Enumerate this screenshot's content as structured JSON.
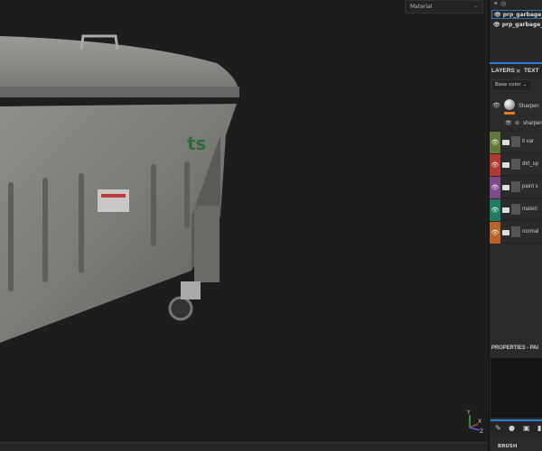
{
  "viewport": {
    "display_mode": "Material",
    "gizmo_axes": [
      "Y",
      "X",
      "Z"
    ]
  },
  "texture_sets": [
    "prp_garbage_c",
    "prp_garbage_c"
  ],
  "layers_panel": {
    "tabs": [
      "LAYERS",
      "TEXT"
    ],
    "channel": "Base color",
    "top_layer": {
      "name": "Sharpen",
      "filter": "sharpen"
    },
    "layers": [
      {
        "name": "lt var",
        "color": "#5f7a3a"
      },
      {
        "name": "dirt_sp",
        "color": "#b03a2e"
      },
      {
        "name": "paint s",
        "color": "#7d4a8e"
      },
      {
        "name": "materi",
        "color": "#1f7a62"
      },
      {
        "name": "normal",
        "color": "#b8622a"
      }
    ]
  },
  "properties": {
    "title": "PROPERTIES - PAI"
  },
  "tools": [
    "brush-icon",
    "sphere-icon",
    "stamp-icon"
  ],
  "brush_section": "BRUSH"
}
